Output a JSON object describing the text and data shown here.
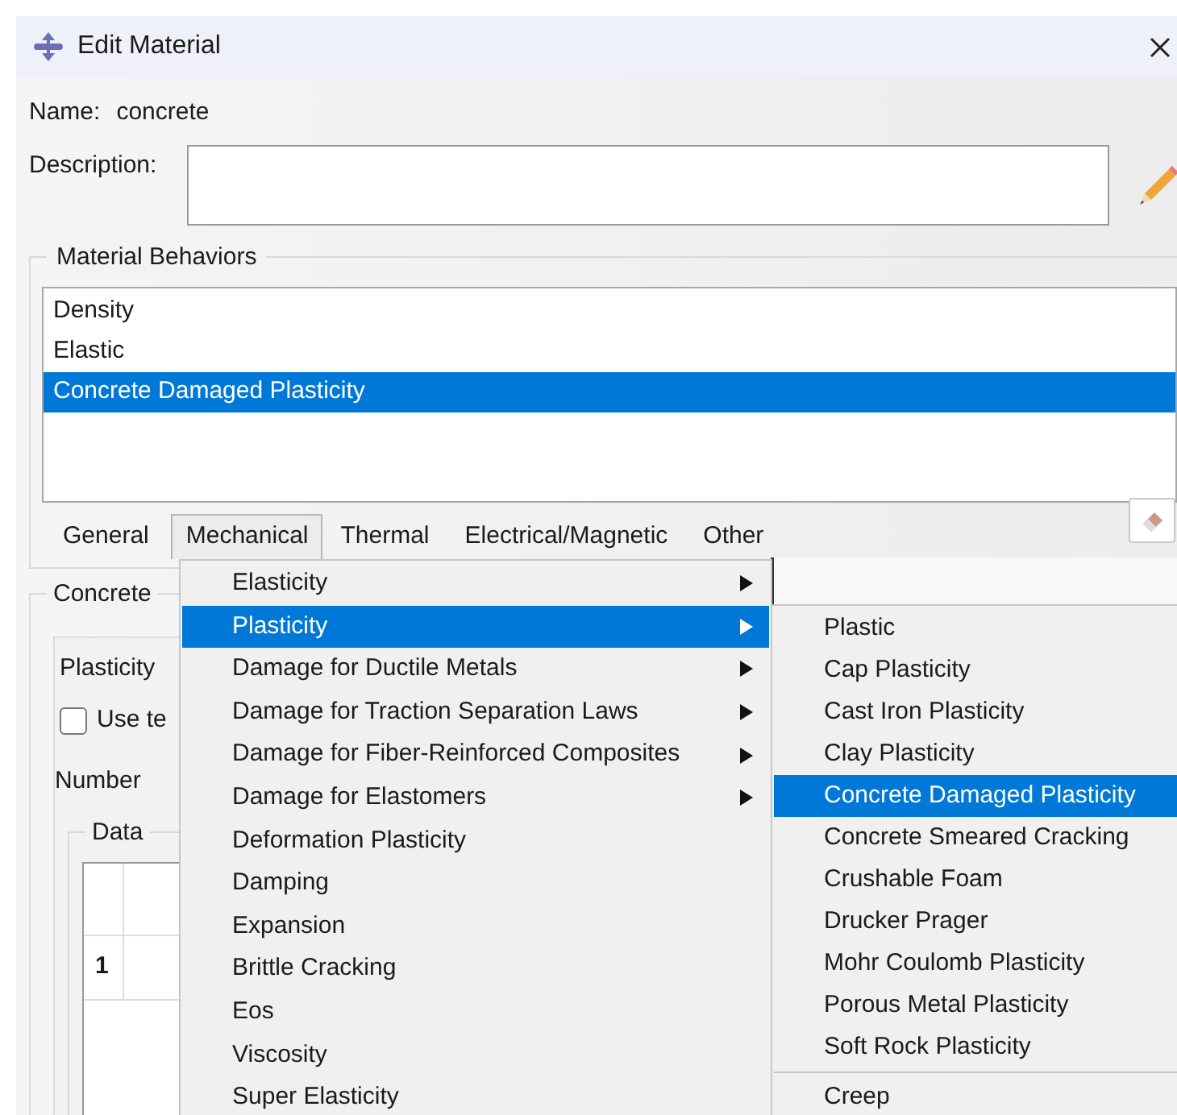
{
  "window": {
    "title": "Edit Material"
  },
  "name": {
    "label": "Name:",
    "value": "concrete"
  },
  "description": {
    "label": "Description:"
  },
  "material_behaviors": {
    "title": "Material Behaviors",
    "items": [
      {
        "label": "Density",
        "selected": false
      },
      {
        "label": "Elastic",
        "selected": false
      },
      {
        "label": "Concrete Damaged Plasticity",
        "selected": true
      }
    ]
  },
  "menu_bar": [
    {
      "label": "General",
      "selected": false
    },
    {
      "label": "Mechanical",
      "selected": true
    },
    {
      "label": "Thermal",
      "selected": false
    },
    {
      "label": "Electrical/Magnetic",
      "selected": false
    },
    {
      "label": "Other",
      "selected": false
    }
  ],
  "behavior_editor": {
    "group_title": "Concrete",
    "tab": "Plasticity",
    "checkbox": {
      "label": "Use te",
      "checked": false
    },
    "number_label": "Number",
    "data_group": "Data",
    "row_number": "1"
  },
  "mechanical_menu": [
    {
      "label": "Elasticity",
      "submenu": true,
      "selected": false
    },
    {
      "label": "Plasticity",
      "submenu": true,
      "selected": true
    },
    {
      "label": "Damage for Ductile Metals",
      "submenu": true,
      "selected": false
    },
    {
      "label": "Damage for Traction Separation Laws",
      "submenu": true,
      "selected": false
    },
    {
      "label": "Damage for Fiber-Reinforced Composites",
      "submenu": true,
      "selected": false
    },
    {
      "label": "Damage for Elastomers",
      "submenu": true,
      "selected": false
    },
    {
      "label": "Deformation Plasticity",
      "submenu": false,
      "selected": false
    },
    {
      "label": "Damping",
      "submenu": false,
      "selected": false
    },
    {
      "label": "Expansion",
      "submenu": false,
      "selected": false
    },
    {
      "label": "Brittle Cracking",
      "submenu": false,
      "selected": false
    },
    {
      "label": "Eos",
      "submenu": false,
      "selected": false
    },
    {
      "label": "Viscosity",
      "submenu": false,
      "selected": false
    },
    {
      "label": "Super Elasticity",
      "submenu": false,
      "selected": false
    }
  ],
  "plasticity_submenu": [
    {
      "kind": "item",
      "label": "Plastic",
      "selected": false
    },
    {
      "kind": "item",
      "label": "Cap Plasticity",
      "selected": false
    },
    {
      "kind": "item",
      "label": "Cast Iron Plasticity",
      "selected": false
    },
    {
      "kind": "item",
      "label": "Clay Plasticity",
      "selected": false
    },
    {
      "kind": "item",
      "label": "Concrete Damaged Plasticity",
      "selected": true
    },
    {
      "kind": "item",
      "label": "Concrete Smeared Cracking",
      "selected": false
    },
    {
      "kind": "item",
      "label": "Crushable Foam",
      "selected": false
    },
    {
      "kind": "item",
      "label": "Drucker Prager",
      "selected": false
    },
    {
      "kind": "item",
      "label": "Mohr Coulomb Plasticity",
      "selected": false
    },
    {
      "kind": "item",
      "label": "Porous Metal Plasticity",
      "selected": false
    },
    {
      "kind": "item",
      "label": "Soft Rock Plasticity",
      "selected": false
    },
    {
      "kind": "separator"
    },
    {
      "kind": "item",
      "label": "Creep",
      "selected": false
    }
  ]
}
